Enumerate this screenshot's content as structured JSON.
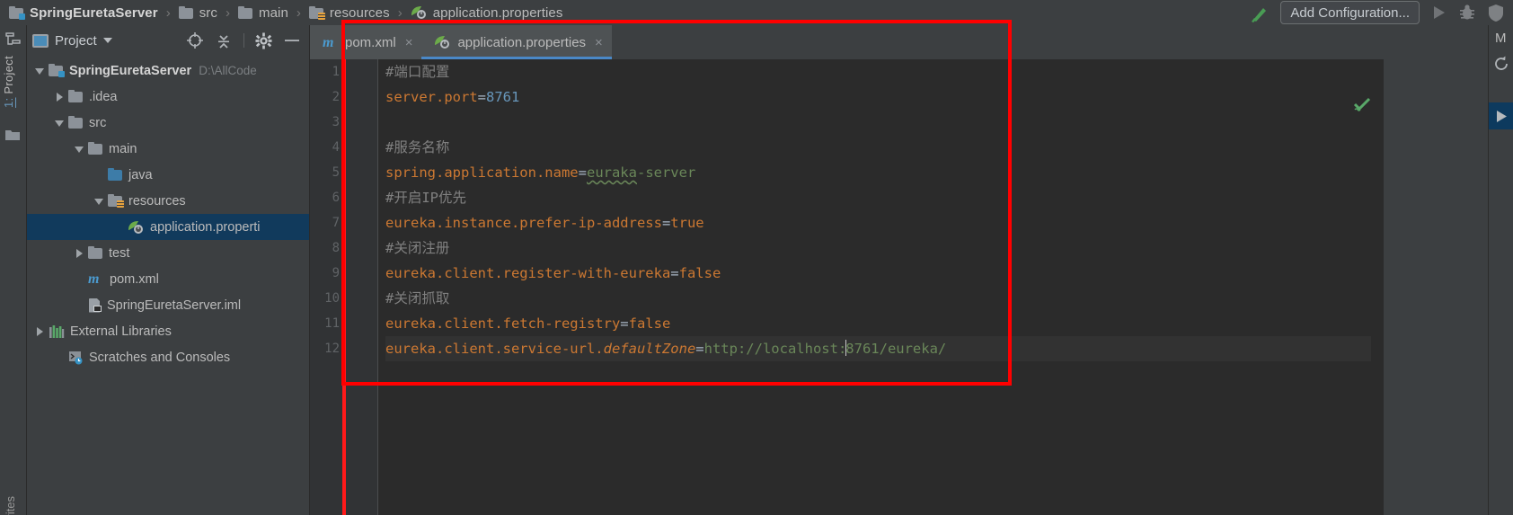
{
  "window": {
    "theme_bg": "#3c3f41",
    "editor_bg": "#2b2b2b",
    "accent": "#4a88c7",
    "annotation_color": "#ff0000"
  },
  "navbar": {
    "crumbs": [
      {
        "label": "SpringEuretaServer",
        "icon": "module-folder-icon"
      },
      {
        "label": "src",
        "icon": "folder-icon"
      },
      {
        "label": "main",
        "icon": "folder-icon"
      },
      {
        "label": "resources",
        "icon": "resources-folder-icon"
      },
      {
        "label": "application.properties",
        "icon": "spring-properties-icon"
      }
    ],
    "separator": "›",
    "build_icon": "build-hammer-icon",
    "add_configuration": "Add Configuration...",
    "run_icon": "run-play-icon",
    "debug_icon": "debug-bug-icon",
    "coverage_icon": "coverage-shield-icon"
  },
  "left_strip": {
    "project_tab_number": "1:",
    "project_tab_label": " Project",
    "structure_icon": "structure-icon",
    "favorites_icon": "favorites-folder-icon",
    "bottom_label": "rites"
  },
  "project_panel": {
    "header": {
      "view_label": "Project",
      "view_icon": "project-view-icon",
      "caret_icon": "chevron-down-icon",
      "locate_icon": "scroll-from-source-icon",
      "collapse_icon": "collapse-all-icon",
      "settings_icon": "gear-icon",
      "hide_icon": "hide-panel-icon"
    },
    "tree": [
      {
        "label": "SpringEuretaServer",
        "suffix": "D:\\AllCode",
        "icon": "module-folder-icon",
        "arrow": "open",
        "indent": 0,
        "bold": true,
        "selected": false
      },
      {
        "label": ".idea",
        "suffix": "",
        "icon": "folder-icon",
        "arrow": "closed",
        "indent": 1,
        "bold": false,
        "selected": false
      },
      {
        "label": "src",
        "suffix": "",
        "icon": "folder-icon",
        "arrow": "open",
        "indent": 1,
        "bold": false,
        "selected": false
      },
      {
        "label": "main",
        "suffix": "",
        "icon": "folder-icon",
        "arrow": "open",
        "indent": 2,
        "bold": false,
        "selected": false
      },
      {
        "label": "java",
        "suffix": "",
        "icon": "source-folder-icon",
        "arrow": "none",
        "indent": 3,
        "bold": false,
        "selected": false
      },
      {
        "label": "resources",
        "suffix": "",
        "icon": "resources-folder-icon",
        "arrow": "open",
        "indent": 3,
        "bold": false,
        "selected": false
      },
      {
        "label": "application.properti",
        "suffix": "",
        "icon": "spring-properties-icon",
        "arrow": "none",
        "indent": 4,
        "bold": false,
        "selected": true
      },
      {
        "label": "test",
        "suffix": "",
        "icon": "folder-icon",
        "arrow": "closed",
        "indent": 2,
        "bold": false,
        "selected": false
      },
      {
        "label": "pom.xml",
        "suffix": "",
        "icon": "maven-icon",
        "arrow": "none",
        "indent": 2,
        "bold": false,
        "selected": false
      },
      {
        "label": "SpringEuretaServer.iml",
        "suffix": "",
        "icon": "iml-file-icon",
        "arrow": "none",
        "indent": 2,
        "bold": false,
        "selected": false
      },
      {
        "label": "External Libraries",
        "suffix": "",
        "icon": "libraries-icon",
        "arrow": "closed",
        "indent": 0,
        "bold": false,
        "selected": false
      },
      {
        "label": "Scratches and Consoles",
        "suffix": "",
        "icon": "scratches-icon",
        "arrow": "none",
        "indent": 1,
        "bold": false,
        "selected": false
      }
    ]
  },
  "editor": {
    "tabs": [
      {
        "label": "pom.xml",
        "icon": "maven-icon",
        "active": false,
        "close": "×",
        "modified_marker": true
      },
      {
        "label": "application.properties",
        "icon": "spring-properties-icon",
        "active": true,
        "close": "×",
        "modified_marker": false
      }
    ],
    "inspection_status_icon": "inspections-ok-check-icon",
    "lines": [
      {
        "n": "1",
        "tokens": [
          {
            "t": "comment",
            "v": "#端口配置"
          }
        ]
      },
      {
        "n": "2",
        "tokens": [
          {
            "t": "key",
            "v": "server.port"
          },
          {
            "t": "eq",
            "v": "="
          },
          {
            "t": "number",
            "v": "8761"
          }
        ]
      },
      {
        "n": "3",
        "tokens": [
          {
            "t": "plain",
            "v": ""
          }
        ]
      },
      {
        "n": "4",
        "tokens": [
          {
            "t": "comment",
            "v": "#服务名称"
          }
        ]
      },
      {
        "n": "5",
        "tokens": [
          {
            "t": "key",
            "v": "spring.application.name"
          },
          {
            "t": "eq",
            "v": "="
          },
          {
            "t": "typo",
            "v": "euraka"
          },
          {
            "t": "string",
            "v": "-server"
          }
        ]
      },
      {
        "n": "6",
        "tokens": [
          {
            "t": "comment",
            "v": "#开启IP优先"
          }
        ]
      },
      {
        "n": "7",
        "tokens": [
          {
            "t": "key",
            "v": "eureka.instance.prefer-ip-address"
          },
          {
            "t": "eq",
            "v": "="
          },
          {
            "t": "key",
            "v": "true"
          }
        ]
      },
      {
        "n": "8",
        "tokens": [
          {
            "t": "comment",
            "v": "#关闭注册"
          }
        ]
      },
      {
        "n": "9",
        "tokens": [
          {
            "t": "key",
            "v": "eureka.client.register-with-eureka"
          },
          {
            "t": "eq",
            "v": "="
          },
          {
            "t": "key",
            "v": "false"
          }
        ]
      },
      {
        "n": "10",
        "tokens": [
          {
            "t": "comment",
            "v": "#关闭抓取"
          }
        ]
      },
      {
        "n": "11",
        "tokens": [
          {
            "t": "key",
            "v": "eureka.client.fetch-registry"
          },
          {
            "t": "eq",
            "v": "="
          },
          {
            "t": "key",
            "v": "false"
          }
        ]
      },
      {
        "n": "12",
        "current": true,
        "tokens": [
          {
            "t": "key",
            "v": "eureka.client.service-url."
          },
          {
            "t": "italic",
            "v": "defaultZone"
          },
          {
            "t": "eq",
            "v": "="
          },
          {
            "t": "string",
            "v": "http://localhost:"
          },
          {
            "t": "caret",
            "v": ""
          },
          {
            "t": "string",
            "v": "8761/eureka/"
          }
        ]
      }
    ]
  },
  "right_strip": {
    "maven_label": "M",
    "refresh_icon": "refresh-icon",
    "run_icon": "run-play-icon"
  }
}
